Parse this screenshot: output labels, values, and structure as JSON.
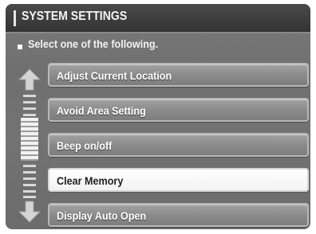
{
  "header": {
    "title": "SYSTEM SETTINGS",
    "instruction": "Select one of the following."
  },
  "menu": {
    "items": [
      {
        "label": "Adjust Current Location",
        "selected": false
      },
      {
        "label": "Avoid Area Setting",
        "selected": false
      },
      {
        "label": "Beep on/off",
        "selected": false
      },
      {
        "label": "Clear Memory",
        "selected": true
      },
      {
        "label": "Display Auto Open",
        "selected": false
      }
    ]
  },
  "scrollbar": {
    "up_icon": "arrow-up-icon",
    "down_icon": "arrow-down-icon",
    "position_fraction": 0.3
  },
  "colors": {
    "screen_bg": "#737373",
    "titlebar_bg": "#3a3a3a",
    "selected_item_bg": "#ffffff",
    "item_bg": "#8f8f8f"
  }
}
